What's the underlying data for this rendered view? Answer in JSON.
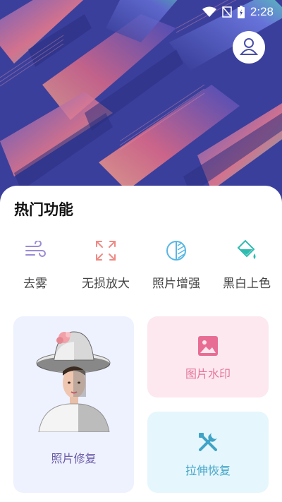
{
  "status_bar": {
    "time": "2:28",
    "icons": [
      "wifi-icon",
      "signal-icon",
      "battery-icon"
    ]
  },
  "profile": {
    "icon": "user-icon"
  },
  "section": {
    "title": "热门功能"
  },
  "quick_actions": [
    {
      "label": "去雾",
      "icon": "wind-icon",
      "color": "#9b8bd6"
    },
    {
      "label": "无损放大",
      "icon": "expand-icon",
      "color": "#f08a84"
    },
    {
      "label": "照片增强",
      "icon": "contrast-icon",
      "color": "#58b6e4"
    },
    {
      "label": "黑白上色",
      "icon": "paint-bucket-icon",
      "color": "#2fbcb0"
    }
  ],
  "cards": {
    "restore": {
      "label": "照片修复",
      "image": "portrait-image"
    },
    "watermark": {
      "label": "图片水印",
      "icon": "image-icon",
      "color": "#e86d95"
    },
    "stretch": {
      "label": "拉伸恢复",
      "icon": "tools-icon",
      "color": "#3fa4c6"
    }
  },
  "colors": {
    "banner_bg": "#3b3f9c",
    "banner_wave_pink": "#ee7b8b",
    "banner_wave_teal": "#59d6b8"
  }
}
